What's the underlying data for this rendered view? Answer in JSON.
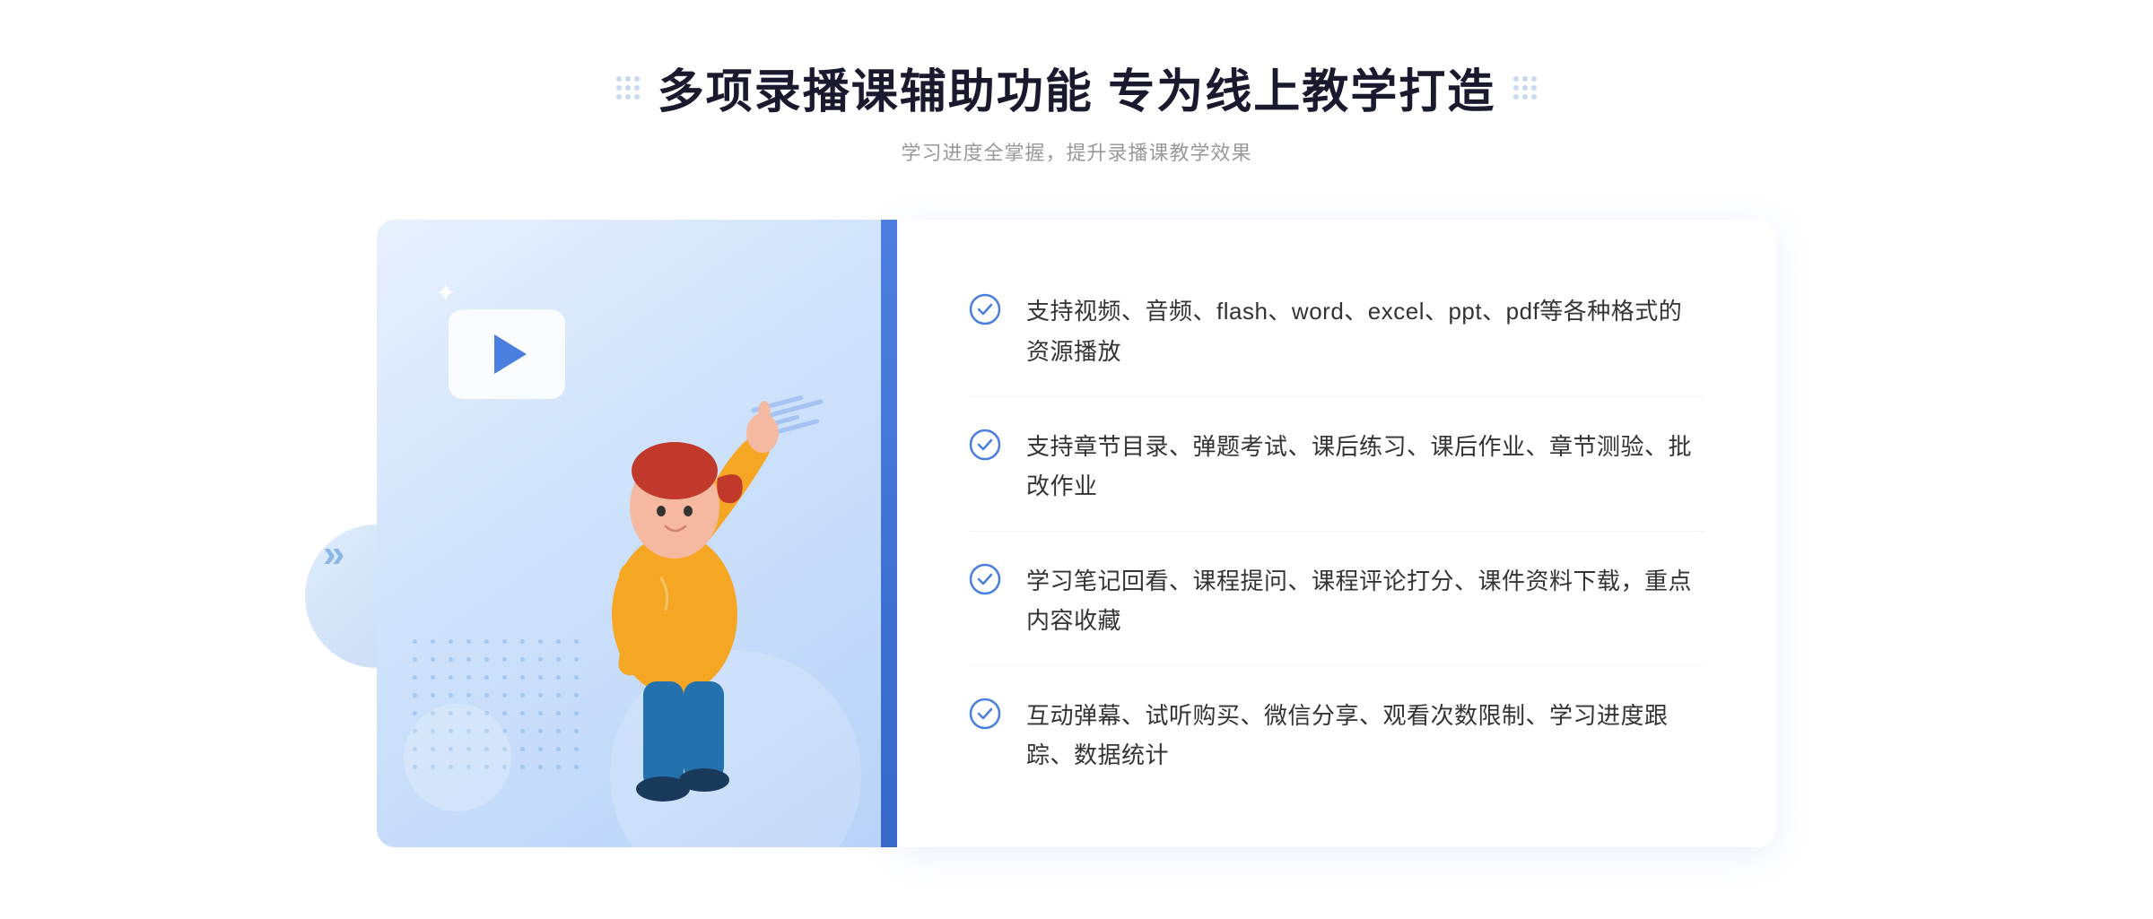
{
  "header": {
    "title": "多项录播课辅助功能 专为线上教学打造",
    "subtitle": "学习进度全掌握，提升录播课教学效果"
  },
  "features": [
    {
      "id": 1,
      "text": "支持视频、音频、flash、word、excel、ppt、pdf等各种格式的资源播放"
    },
    {
      "id": 2,
      "text": "支持章节目录、弹题考试、课后练习、课后作业、章节测验、批改作业"
    },
    {
      "id": 3,
      "text": "学习笔记回看、课程提问、课程评论打分、课件资料下载，重点内容收藏"
    },
    {
      "id": 4,
      "text": "互动弹幕、试听购买、微信分享、观看次数限制、学习进度跟踪、数据统计"
    }
  ],
  "decoration": {
    "arrow_left": "»",
    "check_symbol": "✓"
  }
}
